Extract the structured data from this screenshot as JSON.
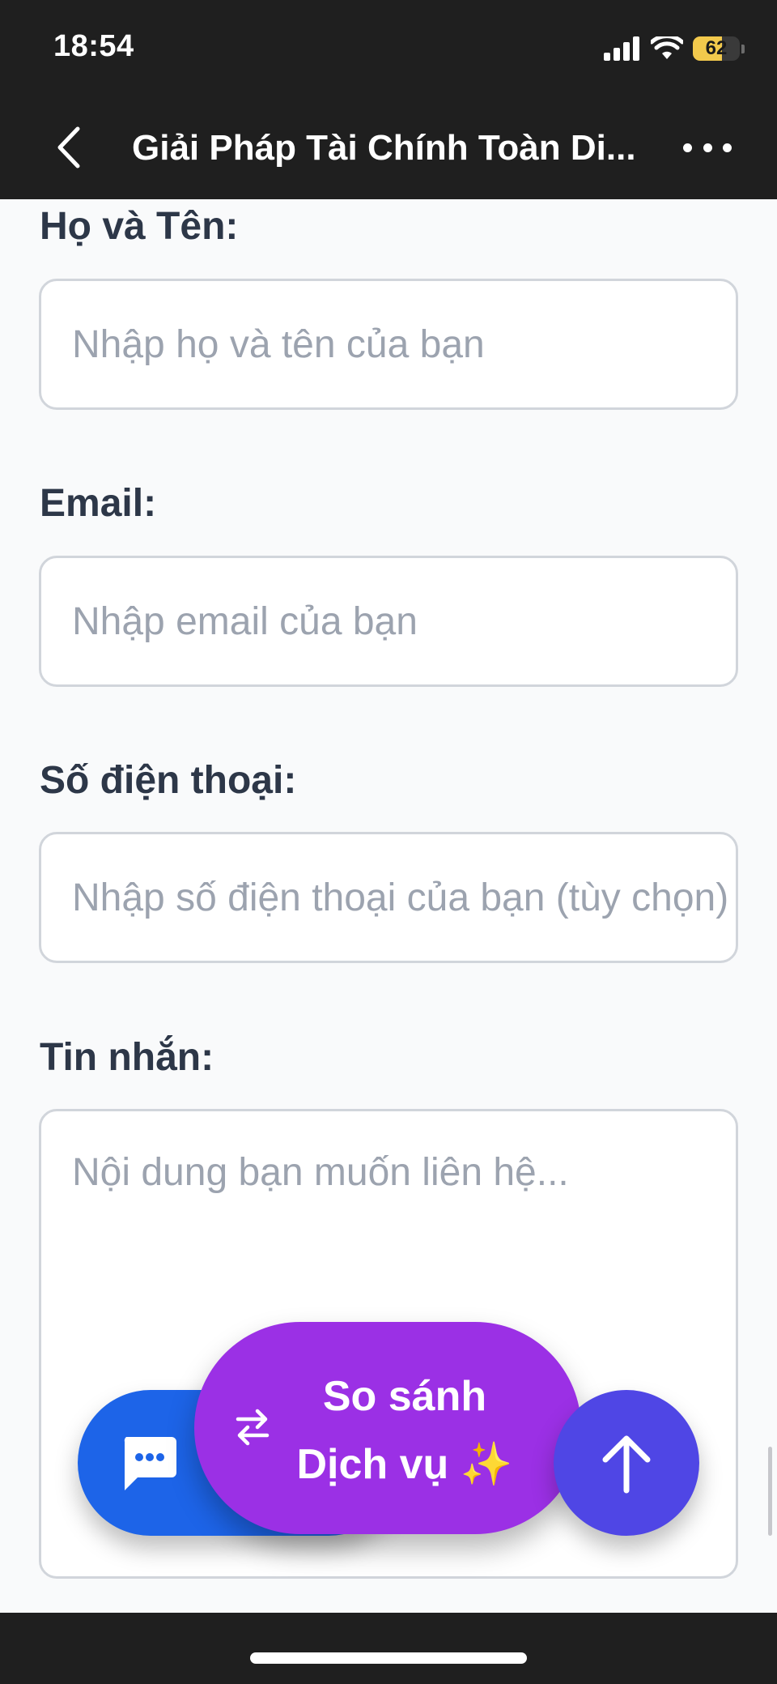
{
  "status_bar": {
    "time": "18:54",
    "battery_level": "62",
    "battery_fraction": 0.62,
    "icons": [
      "cellular-signal-icon",
      "wifi-icon",
      "battery-icon"
    ]
  },
  "nav": {
    "title": "Giải Pháp Tài Chính Toàn Di...",
    "back_icon": "chevron-left-icon",
    "more_icon": "more-horizontal-icon"
  },
  "form": {
    "name": {
      "label": "Họ và Tên:",
      "placeholder": "Nhập họ và tên của bạn"
    },
    "email": {
      "label": "Email:",
      "placeholder": "Nhập email của bạn"
    },
    "phone": {
      "label": "Số điện thoại:",
      "placeholder": "Nhập số điện thoại của bạn (tùy chọn)"
    },
    "message": {
      "label": "Tin nhắn:",
      "placeholder": "Nội dung bạn muốn liên hệ..."
    }
  },
  "floating": {
    "compare_line1": "So sánh",
    "compare_line2": "Dịch vụ ✨",
    "chat_icon": "chat-bubble-icon",
    "compare_icon": "swap-arrows-icon",
    "top_icon": "arrow-up-icon"
  },
  "colors": {
    "chat_button": "#1d64e8",
    "compare_button": "#9b30e5",
    "scroll_top_button": "#4f46e5",
    "label_text": "#2d3748",
    "placeholder_text": "#9ca3af"
  }
}
